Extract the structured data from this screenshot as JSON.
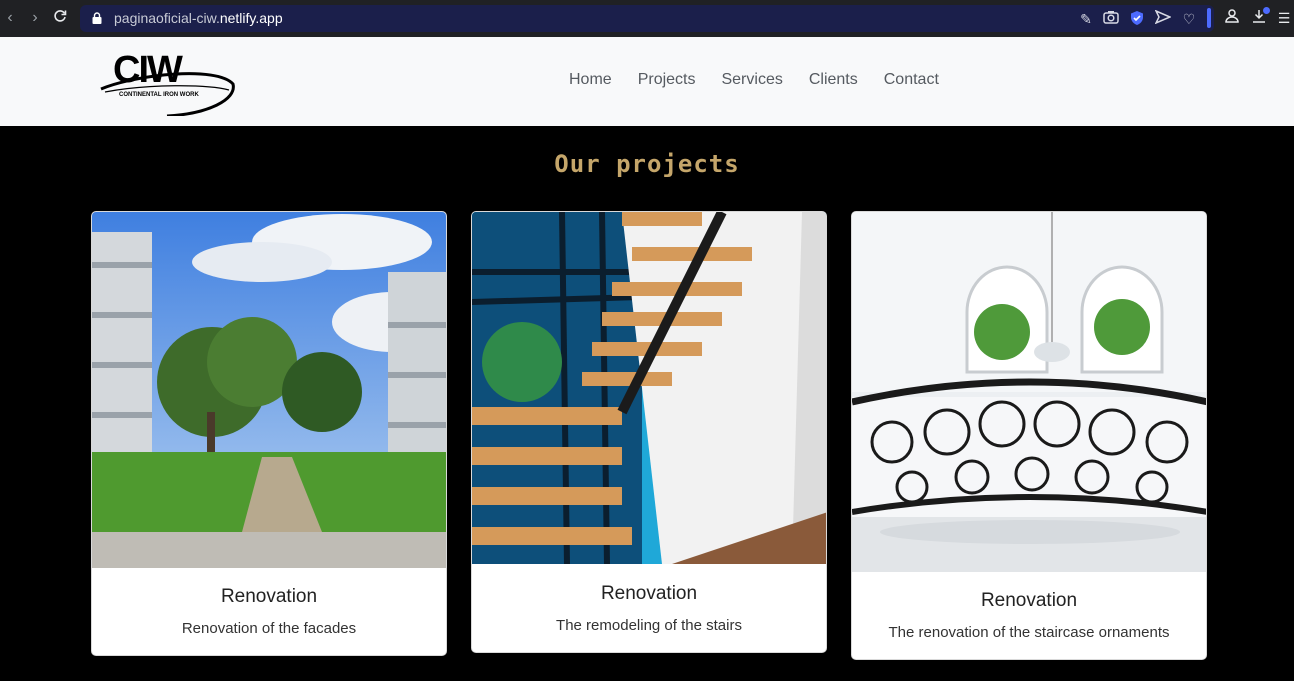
{
  "browser": {
    "url_prefix": "paginaoficial-ciw.",
    "url_domain": "netlify.app",
    "back_icon": "chevron-left-icon",
    "forward_icon": "chevron-right-icon",
    "reload_icon": "reload-icon",
    "accent_color": "#4d6bff"
  },
  "header": {
    "logo_text": "CIW",
    "logo_subtext": "CONTINENTAL IRON WORK",
    "nav": [
      {
        "label": "Home"
      },
      {
        "label": "Projects"
      },
      {
        "label": "Services"
      },
      {
        "label": "Clients"
      },
      {
        "label": "Contact"
      }
    ]
  },
  "main": {
    "title": "Our projects",
    "title_color": "#c5a66a",
    "cards": [
      {
        "title": "Renovation",
        "text": "Renovation of the facades",
        "image": "apartment-building-courtyard-photo"
      },
      {
        "title": "Renovation",
        "text": "The remodeling of the stairs",
        "image": "floating-wood-staircase-photo"
      },
      {
        "title": "Renovation",
        "text": "The renovation of the staircase ornaments",
        "image": "wrought-iron-railing-photo"
      }
    ]
  }
}
